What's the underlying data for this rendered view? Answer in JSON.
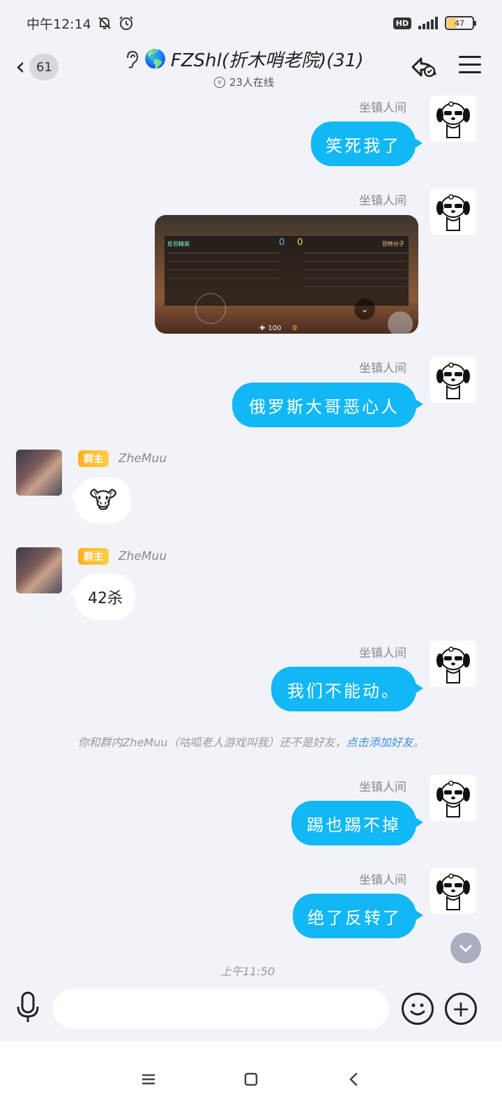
{
  "status_bar": {
    "time": "中午12:14",
    "network_badge": "HD",
    "battery": "47"
  },
  "header": {
    "unread_count": "61",
    "title": "FZShl(折木哨老院)(31)",
    "online": "23人在线"
  },
  "messages": [
    {
      "sender": "坐镇人间",
      "text": "笑死我了"
    },
    {
      "sender": "坐镇人间",
      "image": "game-screenshot"
    },
    {
      "sender": "坐镇人间",
      "text": "俄罗斯大哥恶心人"
    },
    {
      "sender": "ZheMuu",
      "role": "群主",
      "text": "🐮"
    },
    {
      "sender": "ZheMuu",
      "role": "群主",
      "text": "42杀"
    },
    {
      "sender": "坐镇人间",
      "text": "我们不能动。"
    },
    {
      "sender": "坐镇人间",
      "text": "踢也踢不掉"
    },
    {
      "sender": "坐镇人间",
      "text": "绝了反转了"
    }
  ],
  "system_note": {
    "text": "你和群内ZheMuu（咕呱老人游戏叫我）还不是好友，",
    "link": "点击添加好友",
    "end": "。"
  },
  "time_separator": "上午11:50",
  "input": {
    "placeholder": ""
  },
  "colors": {
    "bubble_out": "#12b7f5",
    "background": "#f2f3f8",
    "role_badge": "#ffb020",
    "link": "#3a8ee6"
  },
  "game_screenshot": {
    "header_left": "反恐精英",
    "score_a": "0",
    "score_b": "0",
    "header_right": "恐怖分子",
    "health": "100",
    "ammo": "0"
  }
}
